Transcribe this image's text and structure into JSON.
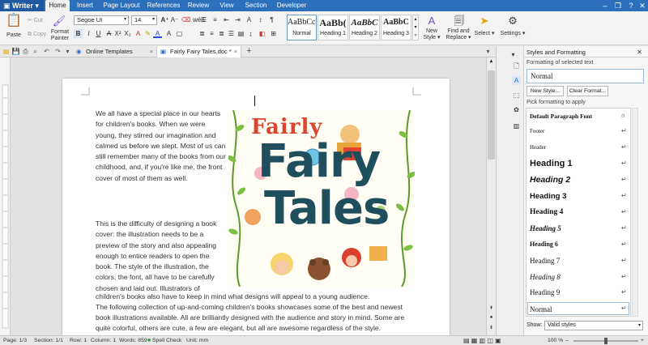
{
  "app": {
    "name": "Writer"
  },
  "menu": {
    "tabs": [
      "Home",
      "Insert",
      "Page Layout",
      "References",
      "Review",
      "View",
      "Section",
      "Developer"
    ]
  },
  "ribbon": {
    "paste": "Paste",
    "cut": "Cut",
    "copy": "Copy",
    "format_painter": "Format Painter",
    "font_name": "Segoe UI",
    "font_size": "14",
    "styles": [
      {
        "preview": "AaBbCcI",
        "name": "Normal"
      },
      {
        "preview": "AaBb(",
        "name": "Heading 1"
      },
      {
        "preview": "AaBbC",
        "name": "Heading 2"
      },
      {
        "preview": "AaBbC",
        "name": "Heading 3"
      }
    ],
    "new_style": "New Style",
    "find_replace": "Find and Replace",
    "select": "Select",
    "settings": "Settings"
  },
  "tabs": [
    {
      "label": "Online Templates"
    },
    {
      "label": "Fairly Fairy Tales.doc *"
    }
  ],
  "document": {
    "p1": "We all have a special place in our hearts for children's books. When we were young, they stirred our imagination and calmed us before we slept. Most of us can still remember many of the books from our childhood, and, if you're like me, the front cover of most of them as well.",
    "p2": "This is the difficulty of designing a book cover: the illustration needs to be a preview of the story and also appealing enough to entice readers to open the book. The style of the illustration, the colors, the font, all have to be carefully chosen and laid out. Illustrators of",
    "line_a": "children's books also have to keep in mind what designs will appeal to a young audience.",
    "line_b": "The following collection of up-and-coming children's books showcases some of the best and newest",
    "line_c": "book illustrations available. All are brilliantly designed with the audience and story in mind. Some are",
    "line_d": "quite colorful, others are cute, a few are elegant, but all are awesome regardless of the style.",
    "cover_title": [
      "Fairly",
      "Fairy",
      "Tales"
    ]
  },
  "panel": {
    "title": "Styles and Formatting",
    "formatting_label": "Formatting of selected text",
    "current_style": "Normal",
    "new_style_btn": "New Style...",
    "clear_format_btn": "Clear Format...",
    "pick_label": "Pick formatting to apply",
    "styles": [
      "Default Paragraph Font",
      "Footer",
      "Header",
      "Heading 1",
      "Heading 2",
      "Heading 3",
      "Heading 4",
      "Heading 5",
      "Heading 6",
      "Heading 7",
      "Heading 8",
      "Heading 9",
      "Normal"
    ],
    "show_label": "Show:",
    "show_value": "Valid styles"
  },
  "status": {
    "page": "Page: 1/3",
    "section": "Section: 1/1",
    "row": "Row: 1",
    "column": "Column: 1",
    "words": "Words: 859",
    "spell": "Spell Check",
    "unit": "Unit: mm",
    "zoom": "100 %",
    "zoom_level": 0.5
  },
  "colors": {
    "accent": "#2c6fbb",
    "title_teal": "#1f4e5c",
    "title_red": "#d9462f",
    "leaf": "#6fae3a"
  }
}
